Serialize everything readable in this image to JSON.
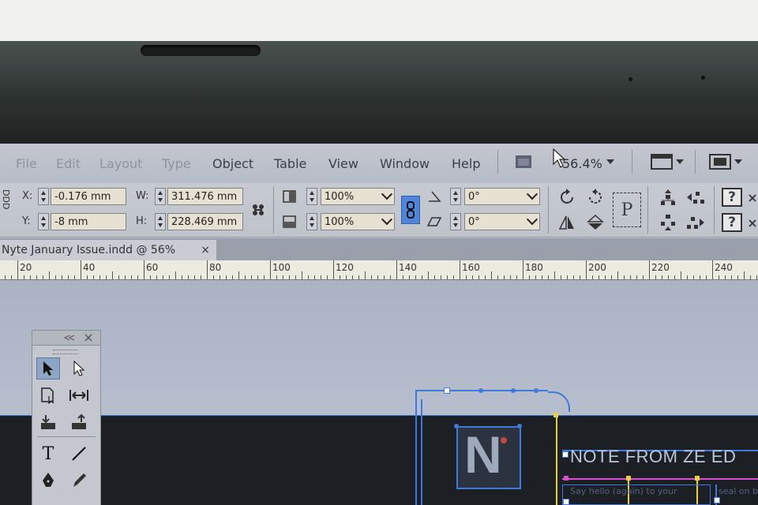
{
  "menu": {
    "items": [
      "File",
      "Edit",
      "Layout",
      "Type",
      "Object",
      "Table",
      "View",
      "Window",
      "Help"
    ],
    "zoom": "56.4%"
  },
  "control": {
    "ref_label": "DDD",
    "x_label": "X:",
    "x_value": "-0.176 mm",
    "y_label": "Y:",
    "y_value": "-8 mm",
    "w_label": "W:",
    "w_value": "311.476 mm",
    "h_label": "H:",
    "h_value": "228.469 mm",
    "scale_x": "100%",
    "scale_y": "100%",
    "rotate": "0°",
    "shear": "0°",
    "p_label": "P",
    "help_glyph": "?"
  },
  "document": {
    "tab_title": "Nyte January Issue.indd @ 56%",
    "close_glyph": "×"
  },
  "ruler": {
    "labels": [
      "20",
      "40",
      "60",
      "80",
      "100",
      "120",
      "140",
      "160",
      "180",
      "200",
      "220",
      "240"
    ]
  },
  "canvas": {
    "logo_letter": "N",
    "heading": "NOTE FROM ZE ED",
    "body_fragment": "Say hello (again) to your",
    "body_fragment_right": "seal on b"
  },
  "colors": {
    "guide": "#3f79d9",
    "frame_yellow": "#e8d23a",
    "frame_magenta": "#d94fd0",
    "page_dark": "#1c1f24",
    "ruler_bg": "#ecebdf"
  }
}
